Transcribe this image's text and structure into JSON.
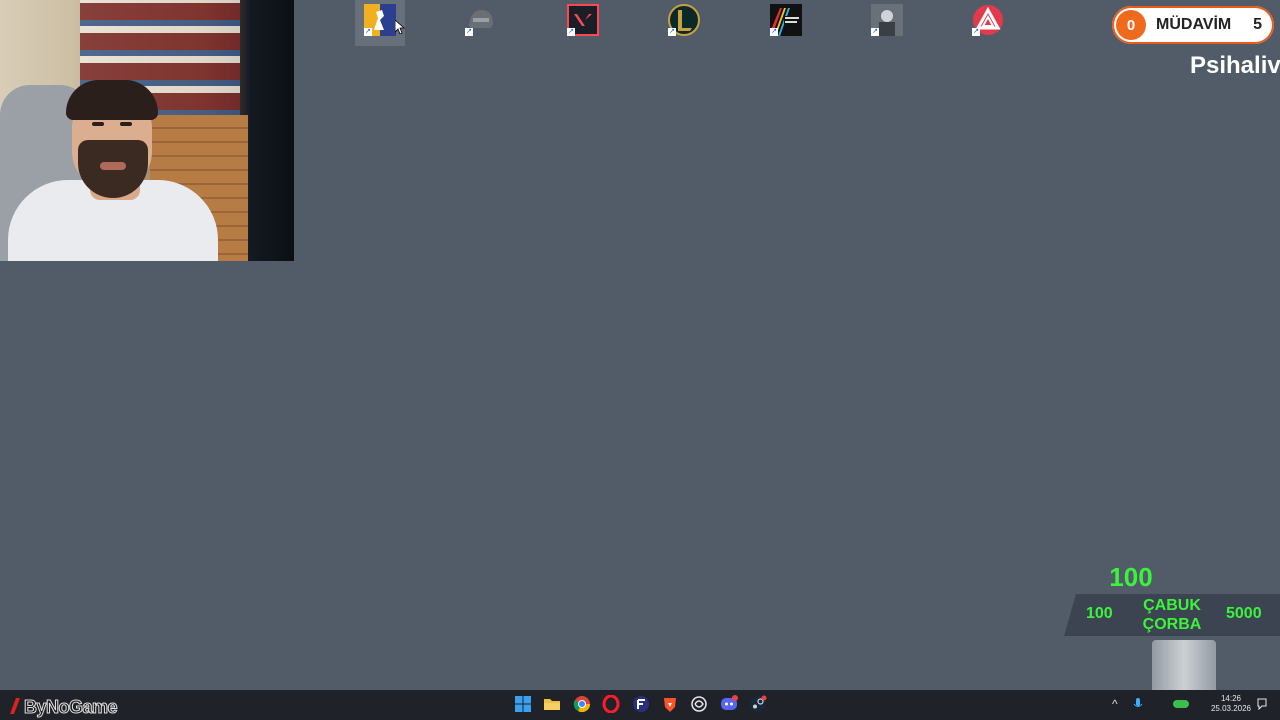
{
  "desktop": {
    "icons": [
      {
        "id": "cs",
        "name": "counter-strike-icon",
        "color": "#2a3f8f",
        "accent": "#f0b020"
      },
      {
        "id": "pubg",
        "name": "pubg-helmet-icon",
        "color": "#4a4f55",
        "accent": "#9aa0a6"
      },
      {
        "id": "valorant",
        "name": "valorant-icon",
        "color": "#1a1e27",
        "accent": "#ff4655"
      },
      {
        "id": "lol",
        "name": "league-of-legends-icon",
        "color": "#0a2a2a",
        "accent": "#c8a040"
      },
      {
        "id": "arc",
        "name": "arc-raiders-icon",
        "color": "#111111",
        "accent": "#e03030"
      },
      {
        "id": "game6",
        "name": "soldier-game-icon",
        "color": "#6a7078",
        "accent": "#cfd4d8"
      },
      {
        "id": "game7",
        "name": "red-triangle-app-icon",
        "color": "#e23a4a",
        "accent": "#ffffff"
      }
    ]
  },
  "loyalty": {
    "badge": "0",
    "label": "MÜDAVİM",
    "count": "5"
  },
  "marquee": {
    "text": "Psihaliv"
  },
  "goal": {
    "current": "100",
    "min": "100",
    "max": "5000",
    "title_line1": "ÇABUK",
    "title_line2": "ÇORBA"
  },
  "taskbar": {
    "brand": "ByNoGame",
    "apps": [
      "windows-start-icon",
      "file-explorer-icon",
      "chrome-icon",
      "opera-icon",
      "custom-app-icon",
      "brave-icon",
      "chatgpt-icon",
      "discord-icon",
      "steam-icon"
    ],
    "clock_time": "14:26",
    "clock_date": "25.03.2026"
  },
  "colors": {
    "desktop": "#525c69",
    "goal_text": "#3cf33c",
    "pill_accent": "#f06a1e",
    "taskbar": "#1f2228"
  }
}
